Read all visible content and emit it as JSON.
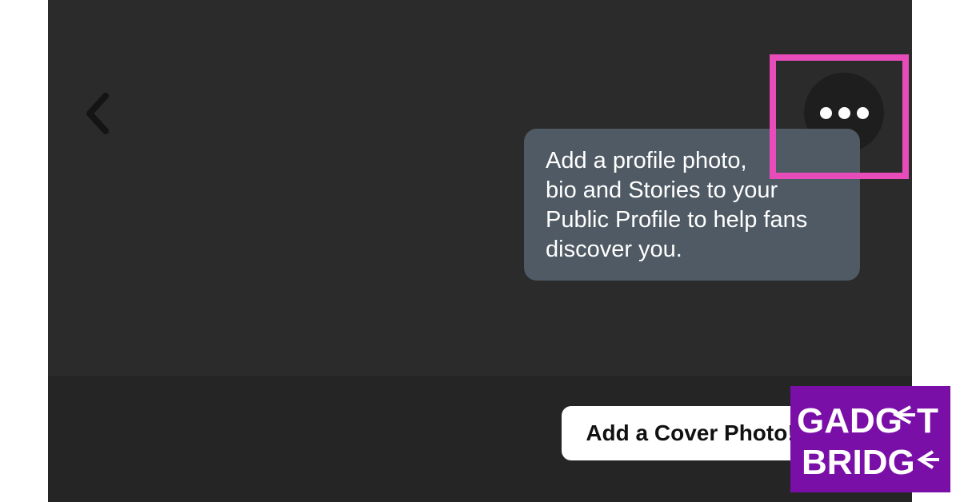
{
  "app": {
    "tooltip": {
      "text": "Add a profile photo,\nbio and Stories to your\nPublic Profile to help fans\ndiscover you."
    },
    "cover_callout": {
      "label": "Add a Cover Photo!"
    },
    "icons": {
      "back": "chevron-left-icon",
      "more": "more-horizontal-icon"
    }
  },
  "watermark": {
    "line1": "GADG",
    "line1_end": "T",
    "line2": "BRIDG"
  },
  "colors": {
    "screen_background": "#2b2b2b",
    "tooltip_background": "#4f5a64",
    "highlight_border": "#e84cba",
    "logo_background": "#7a0fa8"
  }
}
